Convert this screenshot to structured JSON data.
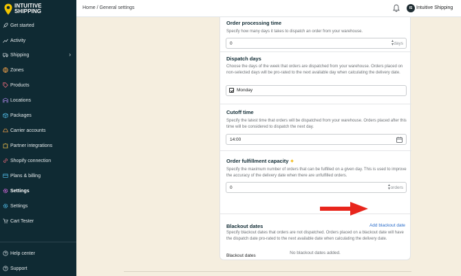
{
  "brand": {
    "line1": "INTUITIVE",
    "line2": "SHIPPING"
  },
  "sidebar": {
    "items": [
      {
        "label": "Get started",
        "icon": "rocket-icon"
      },
      {
        "label": "Activity",
        "icon": "chart-icon"
      },
      {
        "label": "Shipping",
        "icon": "truck-icon",
        "has_chevron": true
      },
      {
        "label": "Zones",
        "icon": "globe-icon"
      },
      {
        "label": "Products",
        "icon": "tag-icon"
      },
      {
        "label": "Locations",
        "icon": "warehouse-icon"
      },
      {
        "label": "Packages",
        "icon": "box-icon"
      },
      {
        "label": "Carrier accounts",
        "icon": "carrier-icon"
      },
      {
        "label": "Partner integrations",
        "icon": "puzzle-icon"
      },
      {
        "label": "Shopify connection",
        "icon": "link-icon"
      },
      {
        "label": "Plans & billing",
        "icon": "card-icon"
      },
      {
        "label": "Settings",
        "icon": "gear-icon",
        "active": true
      },
      {
        "label": "Settings",
        "icon": "gear-icon"
      },
      {
        "label": "Cart Tester",
        "icon": "cart-icon"
      }
    ],
    "footer": [
      {
        "label": "Help center",
        "icon": "help-icon"
      },
      {
        "label": "Support",
        "icon": "support-icon"
      }
    ]
  },
  "header": {
    "breadcrumb": "Home / General settings",
    "avatar_initials": "IS",
    "user_name": "Intuitive Shipping"
  },
  "sections": {
    "processing": {
      "title": "Order processing time",
      "desc": "Specify how many days it takes to dispatch an order from your warehouse.",
      "value": "0",
      "suffix": "days"
    },
    "dispatch": {
      "title": "Dispatch days",
      "desc": "Choose the days of the week that orders are dispatched from your warehouse. Orders placed on non-selected days will be pro-rated to the next available day when calculating the delivery date.",
      "selected": "Monday"
    },
    "cutoff": {
      "title": "Cutoff time",
      "desc": "Specify the latest time that orders will be dispatched from your warehouse. Orders placed after this time will be considered to dispatch the next day.",
      "value": "14:00"
    },
    "capacity": {
      "title": "Order fulfillment capacity",
      "desc": "Specify the maximum number of orders that can be fulfilled on a given day. This is used to improve the accuracy of the delivery date when there are unfulfilled orders.",
      "value": "0",
      "suffix": "orders"
    },
    "blackout": {
      "title": "Blackout dates",
      "add_link": "Add blackout date",
      "desc": "Specify blackout dates that orders are not dispatched. Orders placed on a blackout date will have the dispatch date pro-rated to the next available date when calculating the delivery date.",
      "sub_label": "Blackout dates",
      "empty": "No blackout dates added."
    }
  },
  "colors": {
    "sidebar_bg": "#0f2a33",
    "page_bg": "#f5eedf",
    "accent_link": "#2c6ecb",
    "arrow": "#e8251c",
    "logo_pin": "#f2c500"
  }
}
